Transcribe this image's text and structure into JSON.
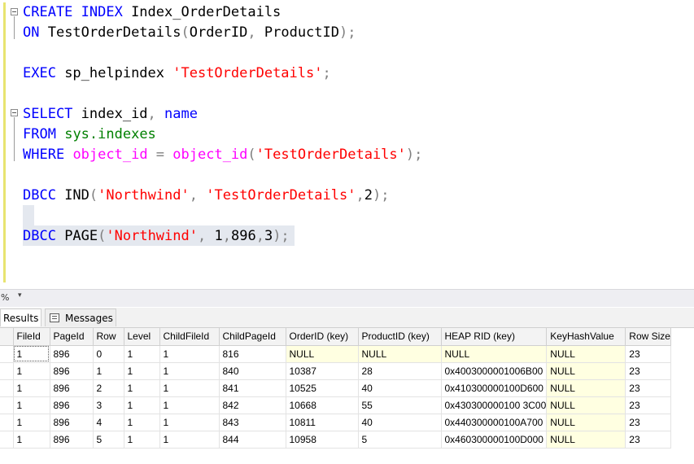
{
  "editor": {
    "lines": [
      {
        "tokens": [
          {
            "t": "CREATE INDEX",
            "c": "kw"
          },
          {
            "t": " Index_OrderDetails",
            "c": "plain"
          }
        ]
      },
      {
        "tokens": [
          {
            "t": "ON",
            "c": "kw"
          },
          {
            "t": " TestOrderDetails",
            "c": "plain"
          },
          {
            "t": "(",
            "c": "pun"
          },
          {
            "t": "OrderID",
            "c": "plain"
          },
          {
            "t": ",",
            "c": "pun"
          },
          {
            "t": " ProductID",
            "c": "plain"
          },
          {
            "t": ");",
            "c": "pun"
          }
        ]
      },
      {
        "tokens": []
      },
      {
        "tokens": [
          {
            "t": "EXEC",
            "c": "kw"
          },
          {
            "t": " sp_helpindex ",
            "c": "plain"
          },
          {
            "t": "'TestOrderDetails'",
            "c": "str"
          },
          {
            "t": ";",
            "c": "pun"
          }
        ]
      },
      {
        "tokens": []
      },
      {
        "tokens": [
          {
            "t": "SELECT",
            "c": "kw"
          },
          {
            "t": " index_id",
            "c": "plain"
          },
          {
            "t": ",",
            "c": "pun"
          },
          {
            "t": " ",
            "c": "plain"
          },
          {
            "t": "name",
            "c": "kw"
          }
        ]
      },
      {
        "tokens": [
          {
            "t": "FROM",
            "c": "kw"
          },
          {
            "t": " ",
            "c": "plain"
          },
          {
            "t": "sys.indexes",
            "c": "sys"
          }
        ]
      },
      {
        "tokens": [
          {
            "t": "WHERE",
            "c": "kw"
          },
          {
            "t": " ",
            "c": "plain"
          },
          {
            "t": "object_id",
            "c": "fn"
          },
          {
            "t": " = ",
            "c": "pun"
          },
          {
            "t": "object_id",
            "c": "fn"
          },
          {
            "t": "(",
            "c": "pun"
          },
          {
            "t": "'TestOrderDetails'",
            "c": "str"
          },
          {
            "t": ");",
            "c": "pun"
          }
        ]
      },
      {
        "tokens": []
      },
      {
        "tokens": [
          {
            "t": "DBCC",
            "c": "kw"
          },
          {
            "t": " IND",
            "c": "plain"
          },
          {
            "t": "(",
            "c": "pun"
          },
          {
            "t": "'Northwind'",
            "c": "str"
          },
          {
            "t": ",",
            "c": "pun"
          },
          {
            "t": " ",
            "c": "plain"
          },
          {
            "t": "'TestOrderDetails'",
            "c": "str"
          },
          {
            "t": ",",
            "c": "pun"
          },
          {
            "t": "2",
            "c": "plain"
          },
          {
            "t": ");",
            "c": "pun"
          }
        ]
      },
      {
        "tokens": []
      },
      {
        "tokens": [
          {
            "t": "DBCC",
            "c": "kw"
          },
          {
            "t": " PAGE",
            "c": "plain"
          },
          {
            "t": "(",
            "c": "pun"
          },
          {
            "t": "'Northwind'",
            "c": "str"
          },
          {
            "t": ",",
            "c": "pun"
          },
          {
            "t": " 1",
            "c": "plain"
          },
          {
            "t": ",",
            "c": "pun"
          },
          {
            "t": "896",
            "c": "plain"
          },
          {
            "t": ",",
            "c": "pun"
          },
          {
            "t": "3",
            "c": "plain"
          },
          {
            "t": ");",
            "c": "pun"
          }
        ]
      }
    ]
  },
  "zoom": {
    "value": "%",
    "arrow": "▾"
  },
  "tabs": {
    "results": "Results",
    "messages": "Messages"
  },
  "grid": {
    "columns": [
      "",
      "FileId",
      "PageId",
      "Row",
      "Level",
      "ChildFileId",
      "ChildPageId",
      "OrderID (key)",
      "ProductID (key)",
      "HEAP RID (key)",
      "KeyHashValue",
      "Row Size"
    ],
    "rows": [
      [
        "1",
        "896",
        "0",
        "1",
        "1",
        "816",
        "NULL",
        "NULL",
        "NULL",
        "NULL",
        "23"
      ],
      [
        "1",
        "896",
        "1",
        "1",
        "1",
        "840",
        "10387",
        "28",
        "0x4003000001006B00",
        "NULL",
        "23"
      ],
      [
        "1",
        "896",
        "2",
        "1",
        "1",
        "841",
        "10525",
        "40",
        "0x410300000100D600",
        "NULL",
        "23"
      ],
      [
        "1",
        "896",
        "3",
        "1",
        "1",
        "842",
        "10668",
        "55",
        "0x430300000100 3C00",
        "NULL",
        "23"
      ],
      [
        "1",
        "896",
        "4",
        "1",
        "1",
        "843",
        "10811",
        "40",
        "0x440300000100A700",
        "NULL",
        "23"
      ],
      [
        "1",
        "896",
        "5",
        "1",
        "1",
        "844",
        "10958",
        "5",
        "0x460300000100D000",
        "NULL",
        "23"
      ]
    ]
  }
}
